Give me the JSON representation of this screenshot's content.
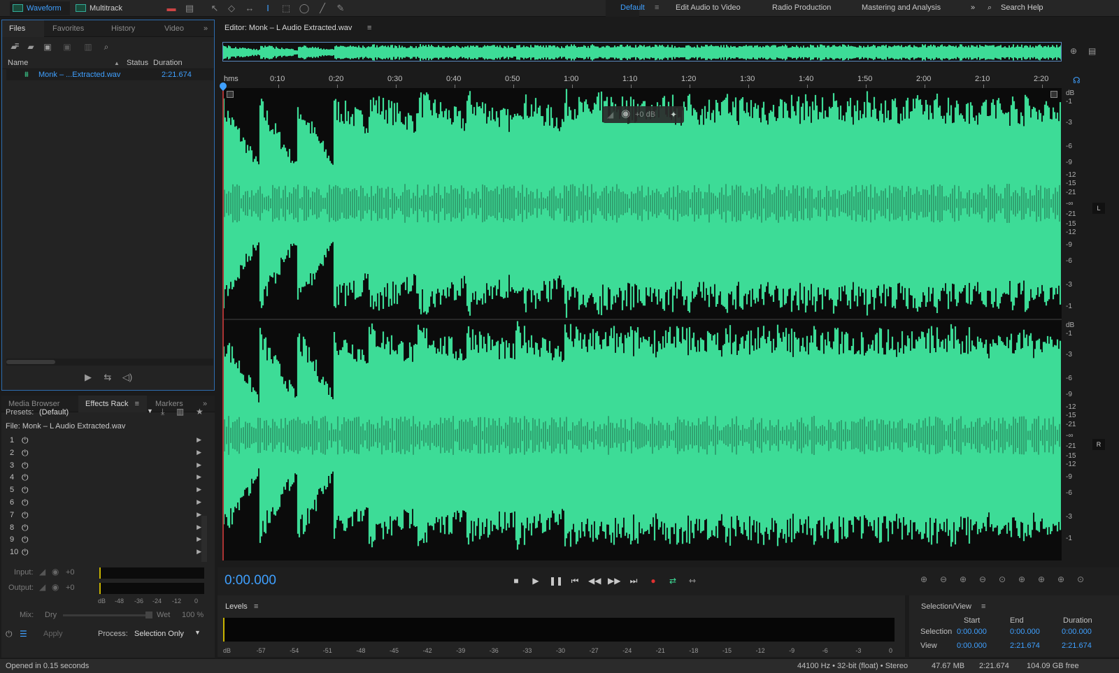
{
  "topbar": {
    "waveform_label": "Waveform",
    "multitrack_label": "Multitrack",
    "workspaces": [
      "Default",
      "Edit Audio to Video",
      "Radio Production",
      "Mastering and Analysis"
    ],
    "search_label": "Search Help"
  },
  "files_panel": {
    "tabs": [
      "Files",
      "Favorites",
      "History",
      "Video"
    ],
    "columns": {
      "name": "Name",
      "status": "Status",
      "duration": "Duration"
    },
    "file": {
      "name": "Monk – ...Extracted.wav",
      "duration": "2:21.674"
    }
  },
  "fx_panel": {
    "tabs": [
      "Media Browser",
      "Effects Rack",
      "Markers"
    ],
    "presets_label": "Presets:",
    "presets_value": "(Default)",
    "file_label": "File: Monk – L Audio Extracted.wav",
    "rack_slots": [
      "1",
      "2",
      "3",
      "4",
      "5",
      "6",
      "7",
      "8",
      "9",
      "10"
    ],
    "input_label": "Input:",
    "output_label": "Output:",
    "input_value": "+0",
    "output_value": "+0",
    "meter_scale": [
      "dB",
      "-48",
      "-36",
      "-24",
      "-12",
      "0"
    ],
    "mix_label": "Mix:",
    "dry_label": "Dry",
    "wet_label": "Wet",
    "wet_value": "100 %",
    "apply_label": "Apply",
    "process_label": "Process:",
    "process_value": "Selection Only"
  },
  "editor": {
    "title": "Editor: Monk – L Audio Extracted.wav",
    "time_unit": "hms",
    "time_ticks": [
      "0:10",
      "0:20",
      "0:30",
      "0:40",
      "0:50",
      "1:00",
      "1:10",
      "1:20",
      "1:30",
      "1:40",
      "1:50",
      "2:00",
      "2:10",
      "2:20"
    ],
    "db_label": "dB",
    "db_labels": [
      "-1",
      "-3",
      "-6",
      "-9",
      "-12",
      "-15",
      "-21",
      "-∞",
      "-21",
      "-15",
      "-12",
      "-9",
      "-6",
      "-3",
      "-1"
    ],
    "channel_left": "L",
    "channel_right": "R",
    "hud_value": "+0 dB",
    "wave_color": "#3ddc97"
  },
  "transport": {
    "timecode": "0:00.000"
  },
  "levels": {
    "title": "Levels",
    "scale": [
      "dB",
      "-57",
      "-54",
      "-51",
      "-48",
      "-45",
      "-42",
      "-39",
      "-36",
      "-33",
      "-30",
      "-27",
      "-24",
      "-21",
      "-18",
      "-15",
      "-12",
      "-9",
      "-6",
      "-3",
      "0"
    ]
  },
  "selection_view": {
    "title": "Selection/View",
    "col_start": "Start",
    "col_end": "End",
    "col_duration": "Duration",
    "row_selection": "Selection",
    "row_view": "View",
    "sel_start": "0:00.000",
    "sel_end": "0:00.000",
    "sel_duration": "0:00.000",
    "view_start": "0:00.000",
    "view_end": "2:21.674",
    "view_duration": "2:21.674"
  },
  "status": {
    "left": "Opened in 0.15 seconds",
    "format": "44100 Hz • 32-bit (float) • Stereo",
    "size": "47.67 MB",
    "duration": "2:21.674",
    "free": "104.09 GB free"
  }
}
